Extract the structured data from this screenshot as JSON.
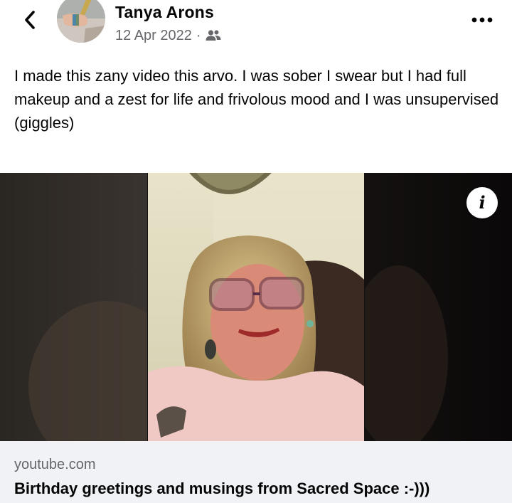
{
  "post": {
    "author": "Tanya Arons",
    "date": "12 Apr 2022",
    "separator": "·",
    "audience_icon": "friends-icon",
    "text": "I made this zany video this arvo.  I was sober I swear but I had full makeup and a zest for life and frivolous mood and I was unsupervised (giggles)"
  },
  "header": {
    "back_icon": "chevron-left-icon",
    "more_icon": "more-options-icon"
  },
  "video": {
    "info_icon": "info-icon",
    "info_glyph": "i"
  },
  "link_preview": {
    "domain": "youtube.com",
    "title": "Birthday greetings and musings from Sacred Space :-)))"
  },
  "colors": {
    "text_primary": "#050505",
    "text_secondary": "#65676b",
    "card_background": "#f0f2f5"
  }
}
